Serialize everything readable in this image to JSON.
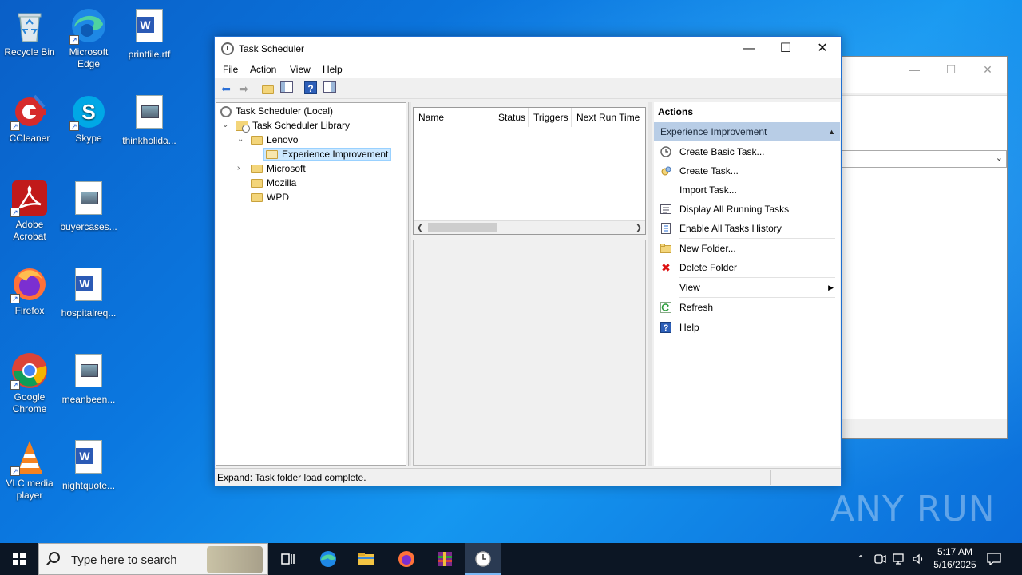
{
  "desktop": {
    "icons": [
      {
        "label": "Recycle Bin"
      },
      {
        "label": "Microsoft Edge"
      },
      {
        "label": "printfile.rtf"
      },
      {
        "label": "CCleaner"
      },
      {
        "label": "Skype"
      },
      {
        "label": "thinkholida..."
      },
      {
        "label": "Adobe Acrobat"
      },
      {
        "label": "buyercases..."
      },
      {
        "label": "Firefox"
      },
      {
        "label": "hospitalreq..."
      },
      {
        "label": "Google Chrome"
      },
      {
        "label": "meanbeen..."
      },
      {
        "label": "VLC media player"
      },
      {
        "label": "nightquote..."
      }
    ],
    "watermark": "ANY RUN"
  },
  "window": {
    "title": "Task Scheduler",
    "menu": [
      "File",
      "Action",
      "View",
      "Help"
    ],
    "tree": {
      "root": "Task Scheduler (Local)",
      "library": "Task Scheduler Library",
      "folders": [
        "Lenovo",
        "Experience Improvement",
        "Microsoft",
        "Mozilla",
        "WPD"
      ]
    },
    "columns": [
      "Name",
      "Status",
      "Triggers",
      "Next Run Time"
    ],
    "actions": {
      "header": "Actions",
      "section": "Experience Improvement",
      "items": [
        {
          "label": "Create Basic Task...",
          "icon": "create-basic-task-icon"
        },
        {
          "label": "Create Task...",
          "icon": "create-task-icon"
        },
        {
          "label": "Import Task...",
          "icon": "none"
        },
        {
          "label": "Display All Running Tasks",
          "icon": "running-tasks-icon"
        },
        {
          "label": "Enable All Tasks History",
          "icon": "history-icon"
        },
        {
          "label": "New Folder...",
          "icon": "folder-icon"
        },
        {
          "label": "Delete Folder",
          "icon": "delete-icon"
        },
        {
          "label": "View",
          "icon": "none"
        },
        {
          "label": "Refresh",
          "icon": "refresh-icon"
        },
        {
          "label": "Help",
          "icon": "help-icon"
        }
      ]
    },
    "status": "Expand:  Task folder load complete."
  },
  "taskbar": {
    "search_placeholder": "Type here to search",
    "time": "5:17 AM",
    "date": "5/16/2025"
  },
  "colors": {
    "desktop": "#0b78e0",
    "taskbar": "#0c1624",
    "selection": "#cce8ff",
    "actions_section": "#b8cde6"
  }
}
